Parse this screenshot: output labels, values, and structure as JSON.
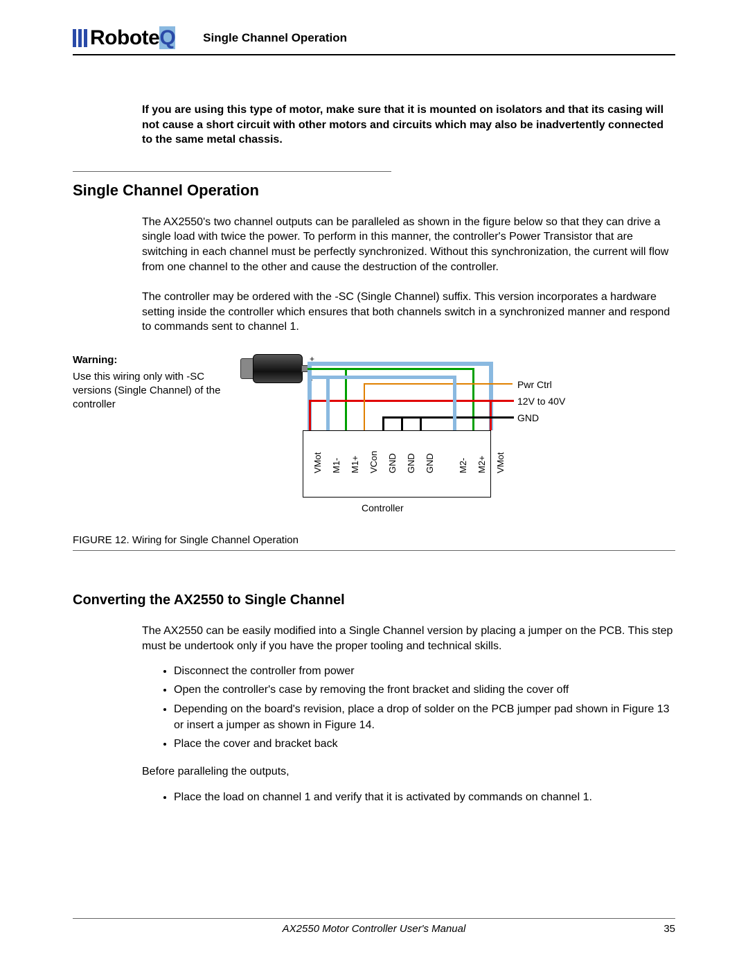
{
  "header": {
    "logo_black": "Robote",
    "logo_blue": "Q",
    "section": "Single Channel Operation"
  },
  "intro_bold": "If you are using this type of motor, make sure that it is mounted on isolators and that its casing will not cause a short circuit with other motors and circuits which may also be inadvertently connected to the same metal chassis.",
  "section1": {
    "heading": "Single Channel Operation",
    "para1": "The AX2550's two channel outputs can be paralleled as shown in the figure below so that they can drive a single load with twice the power. To perform in this manner, the controller's Power Transistor that are switching in each channel must be perfectly synchronized. Without this synchronization, the current will flow from one channel to the other and cause the destruction of the controller.",
    "para2": "The controller may be ordered with the -SC (Single Channel) suffix. This version incorporates a hardware setting inside the controller which ensures that both channels switch in a synchronized manner and respond to commands sent to channel 1."
  },
  "warning": {
    "label": "Warning:",
    "text": "Use this wiring only with -SC versions (Single Channel) of the controller"
  },
  "diagram": {
    "terminal_plus": "+",
    "terminal_minus": "-",
    "controller": "Controller",
    "pins": [
      "VMot",
      "M1-",
      "M1+",
      "VCon",
      "GND",
      "GND",
      "GND",
      "M2-",
      "M2+",
      "VMot"
    ],
    "side_labels": {
      "pwr_ctrl": "Pwr Ctrl",
      "volt": "12V to 40V",
      "gnd": "GND"
    }
  },
  "figure_caption": "FIGURE 12.  Wiring for Single Channel Operation",
  "section2": {
    "heading": "Converting the AX2550 to Single Channel",
    "para1": "The AX2550 can be easily modified into a Single Channel version by placing a jumper on the PCB. This step must be undertook only if you have the proper tooling and technical skills.",
    "steps1": [
      "Disconnect the controller from power",
      "Open the controller's case by removing the front bracket and sliding the cover off",
      "Depending on the board's revision, place  a drop of solder on the PCB jumper pad shown in Figure 13 or insert a jumper as shown in Figure 14.",
      "Place the cover and bracket back"
    ],
    "para2": "Before paralleling the outputs,",
    "steps2": [
      "Place the load on channel 1 and verify that it is activated by commands on channel 1."
    ]
  },
  "footer": {
    "manual": "AX2550 Motor Controller User's Manual",
    "page": "35"
  }
}
